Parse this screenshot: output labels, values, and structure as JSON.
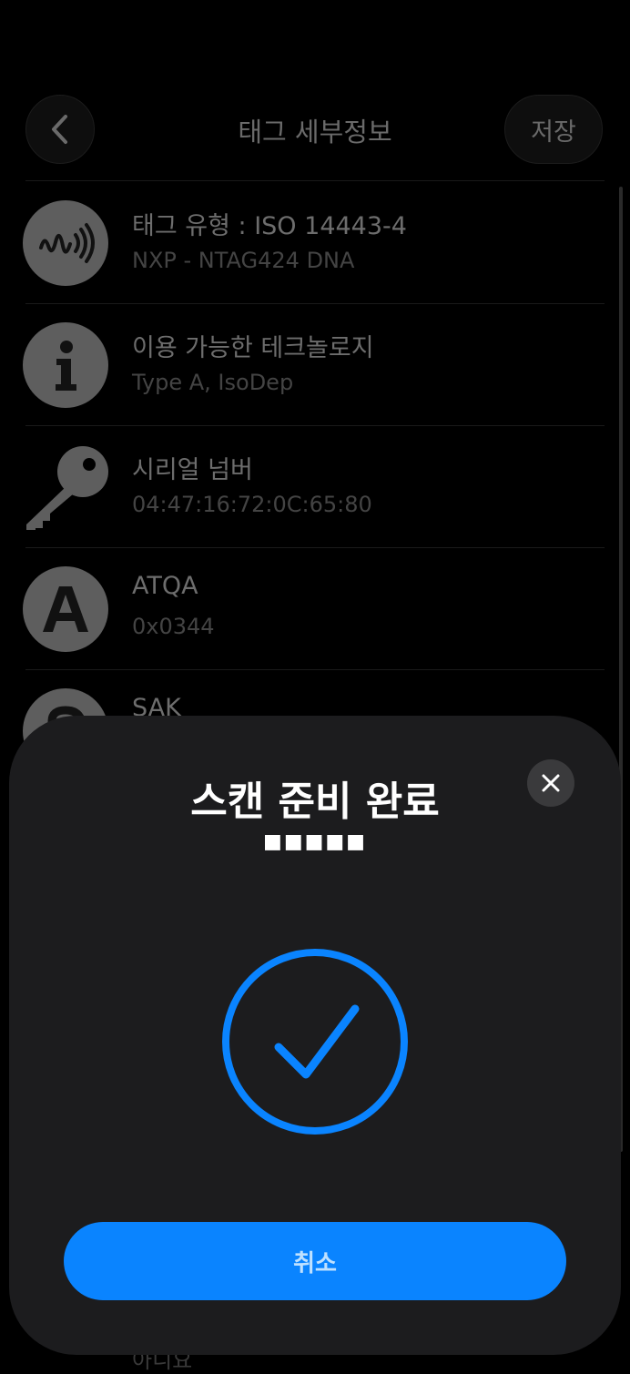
{
  "header": {
    "title": "태그 세부정보",
    "save_label": "저장"
  },
  "rows": [
    {
      "title": "태그 유형 : ISO 14443-4",
      "value": "NXP - NTAG424 DNA",
      "icon": "nfc-tag-icon"
    },
    {
      "title": "이용 가능한 테크놀로지",
      "value": "Type A, IsoDep",
      "icon": "info-icon"
    },
    {
      "title": "시리얼 넘버",
      "value": "04:47:16:72:0C:65:80",
      "icon": "key-icon"
    },
    {
      "title": "ATQA",
      "value": "0x0344",
      "icon": "letter-a-icon"
    },
    {
      "title": "SAK",
      "value": "",
      "icon": "letter-s-icon"
    }
  ],
  "peek_row": {
    "value": "아니요"
  },
  "scan_sheet": {
    "title": "스캔 준비 완료",
    "subtitle": "■■■■■",
    "cancel_label": "취소",
    "status_icon": "checkmark-circle-icon",
    "close_icon": "close-icon"
  },
  "colors": {
    "accent": "#0a84ff",
    "sheet_bg": "#1c1c1e",
    "background": "#000000"
  }
}
